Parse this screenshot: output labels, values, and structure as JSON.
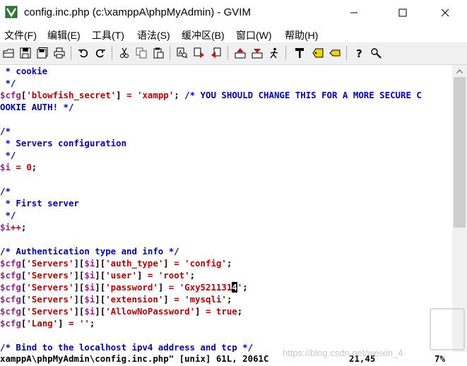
{
  "window": {
    "title": "config.inc.php (c:\\xamppA\\phpMyAdmin) - GVIM"
  },
  "menu": [
    {
      "label": "文件(F)"
    },
    {
      "label": "编辑(E)"
    },
    {
      "label": "工具(T)"
    },
    {
      "label": "语法(S)"
    },
    {
      "label": "缓冲区(B)"
    },
    {
      "label": "窗口(W)"
    },
    {
      "label": "帮助(H)"
    }
  ],
  "toolbar": {
    "icons": [
      "open-icon",
      "save-icon",
      "save-all-icon",
      "print-icon",
      "undo-icon",
      "redo-icon",
      "cut-icon",
      "copy-icon",
      "paste-icon",
      "find-replace-icon",
      "find-next-icon",
      "find-prev-icon",
      "load-session-icon",
      "save-session-icon",
      "run-script-icon",
      "make-icon",
      "run-ctags-icon",
      "jump-tag-icon",
      "help-icon",
      "find-help-icon"
    ]
  },
  "editor": {
    "lines": [
      [
        {
          "t": " * cookie",
          "c": "comment"
        }
      ],
      [
        {
          "t": " */",
          "c": "comment"
        }
      ],
      [
        {
          "t": "$cfg",
          "c": "var"
        },
        {
          "t": "[",
          "c": "plain"
        },
        {
          "t": "'blowfish_secret'",
          "c": "str"
        },
        {
          "t": "] ",
          "c": "plain"
        },
        {
          "t": "=",
          "c": "op"
        },
        {
          "t": " ",
          "c": "plain"
        },
        {
          "t": "'xampp'",
          "c": "str"
        },
        {
          "t": "; ",
          "c": "plain"
        },
        {
          "t": "/* YOU SHOULD CHANGE THIS FOR A MORE SECURE C",
          "c": "comment"
        }
      ],
      [
        {
          "t": "OOKIE AUTH! */",
          "c": "comment"
        }
      ],
      [
        {
          "t": "",
          "c": "plain"
        }
      ],
      [
        {
          "t": "/*",
          "c": "comment"
        }
      ],
      [
        {
          "t": " * Servers configuration",
          "c": "comment"
        }
      ],
      [
        {
          "t": " */",
          "c": "comment"
        }
      ],
      [
        {
          "t": "$i",
          "c": "var"
        },
        {
          "t": " ",
          "c": "plain"
        },
        {
          "t": "=",
          "c": "op"
        },
        {
          "t": " ",
          "c": "plain"
        },
        {
          "t": "0",
          "c": "num"
        },
        {
          "t": ";",
          "c": "plain"
        }
      ],
      [
        {
          "t": "",
          "c": "plain"
        }
      ],
      [
        {
          "t": "/*",
          "c": "comment"
        }
      ],
      [
        {
          "t": " * First server",
          "c": "comment"
        }
      ],
      [
        {
          "t": " */",
          "c": "comment"
        }
      ],
      [
        {
          "t": "$i",
          "c": "var"
        },
        {
          "t": "++",
          "c": "op"
        },
        {
          "t": ";",
          "c": "plain"
        }
      ],
      [
        {
          "t": "",
          "c": "plain"
        }
      ],
      [
        {
          "t": "/* Authentication type and info */",
          "c": "comment"
        }
      ],
      [
        {
          "t": "$cfg",
          "c": "var"
        },
        {
          "t": "[",
          "c": "plain"
        },
        {
          "t": "'Servers'",
          "c": "str"
        },
        {
          "t": "][",
          "c": "plain"
        },
        {
          "t": "$i",
          "c": "var"
        },
        {
          "t": "][",
          "c": "plain"
        },
        {
          "t": "'auth_type'",
          "c": "str"
        },
        {
          "t": "] ",
          "c": "plain"
        },
        {
          "t": "=",
          "c": "op"
        },
        {
          "t": " ",
          "c": "plain"
        },
        {
          "t": "'config'",
          "c": "str"
        },
        {
          "t": ";",
          "c": "plain"
        }
      ],
      [
        {
          "t": "$cfg",
          "c": "var"
        },
        {
          "t": "[",
          "c": "plain"
        },
        {
          "t": "'Servers'",
          "c": "str"
        },
        {
          "t": "][",
          "c": "plain"
        },
        {
          "t": "$i",
          "c": "var"
        },
        {
          "t": "][",
          "c": "plain"
        },
        {
          "t": "'user'",
          "c": "str"
        },
        {
          "t": "] ",
          "c": "plain"
        },
        {
          "t": "=",
          "c": "op"
        },
        {
          "t": " ",
          "c": "plain"
        },
        {
          "t": "'root'",
          "c": "str"
        },
        {
          "t": ";",
          "c": "plain"
        }
      ],
      [
        {
          "t": "$cfg",
          "c": "var"
        },
        {
          "t": "[",
          "c": "plain"
        },
        {
          "t": "'Servers'",
          "c": "str"
        },
        {
          "t": "][",
          "c": "plain"
        },
        {
          "t": "$i",
          "c": "var"
        },
        {
          "t": "][",
          "c": "plain"
        },
        {
          "t": "'password'",
          "c": "str"
        },
        {
          "t": "] ",
          "c": "plain"
        },
        {
          "t": "=",
          "c": "op"
        },
        {
          "t": " ",
          "c": "plain"
        },
        {
          "t": "'Gxy521131",
          "c": "str"
        },
        {
          "t": "4",
          "c": "cursor"
        },
        {
          "t": "'",
          "c": "str"
        },
        {
          "t": ";",
          "c": "plain"
        }
      ],
      [
        {
          "t": "$cfg",
          "c": "var"
        },
        {
          "t": "[",
          "c": "plain"
        },
        {
          "t": "'Servers'",
          "c": "str"
        },
        {
          "t": "][",
          "c": "plain"
        },
        {
          "t": "$i",
          "c": "var"
        },
        {
          "t": "][",
          "c": "plain"
        },
        {
          "t": "'extension'",
          "c": "str"
        },
        {
          "t": "] ",
          "c": "plain"
        },
        {
          "t": "=",
          "c": "op"
        },
        {
          "t": " ",
          "c": "plain"
        },
        {
          "t": "'mysqli'",
          "c": "str"
        },
        {
          "t": ";",
          "c": "plain"
        }
      ],
      [
        {
          "t": "$cfg",
          "c": "var"
        },
        {
          "t": "[",
          "c": "plain"
        },
        {
          "t": "'Servers'",
          "c": "str"
        },
        {
          "t": "][",
          "c": "plain"
        },
        {
          "t": "$i",
          "c": "var"
        },
        {
          "t": "][",
          "c": "plain"
        },
        {
          "t": "'AllowNoPassword'",
          "c": "str"
        },
        {
          "t": "] ",
          "c": "plain"
        },
        {
          "t": "=",
          "c": "op"
        },
        {
          "t": " ",
          "c": "plain"
        },
        {
          "t": "true",
          "c": "kw"
        },
        {
          "t": ";",
          "c": "plain"
        }
      ],
      [
        {
          "t": "$cfg",
          "c": "var"
        },
        {
          "t": "[",
          "c": "plain"
        },
        {
          "t": "'Lang'",
          "c": "str"
        },
        {
          "t": "] ",
          "c": "plain"
        },
        {
          "t": "=",
          "c": "op"
        },
        {
          "t": " ",
          "c": "plain"
        },
        {
          "t": "''",
          "c": "str"
        },
        {
          "t": ";",
          "c": "plain"
        }
      ],
      [
        {
          "t": "",
          "c": "plain"
        }
      ],
      [
        {
          "t": "/* Bind to the localhost ipv4 address and tcp */",
          "c": "comment"
        }
      ]
    ]
  },
  "status": {
    "file_info": "xamppA\\phpMyAdmin\\config.inc.php\" [unix] 61L, 2061C",
    "position": "21,45",
    "percent": "7%"
  },
  "watermark": "https://blog.csdn.net/weixin_4"
}
